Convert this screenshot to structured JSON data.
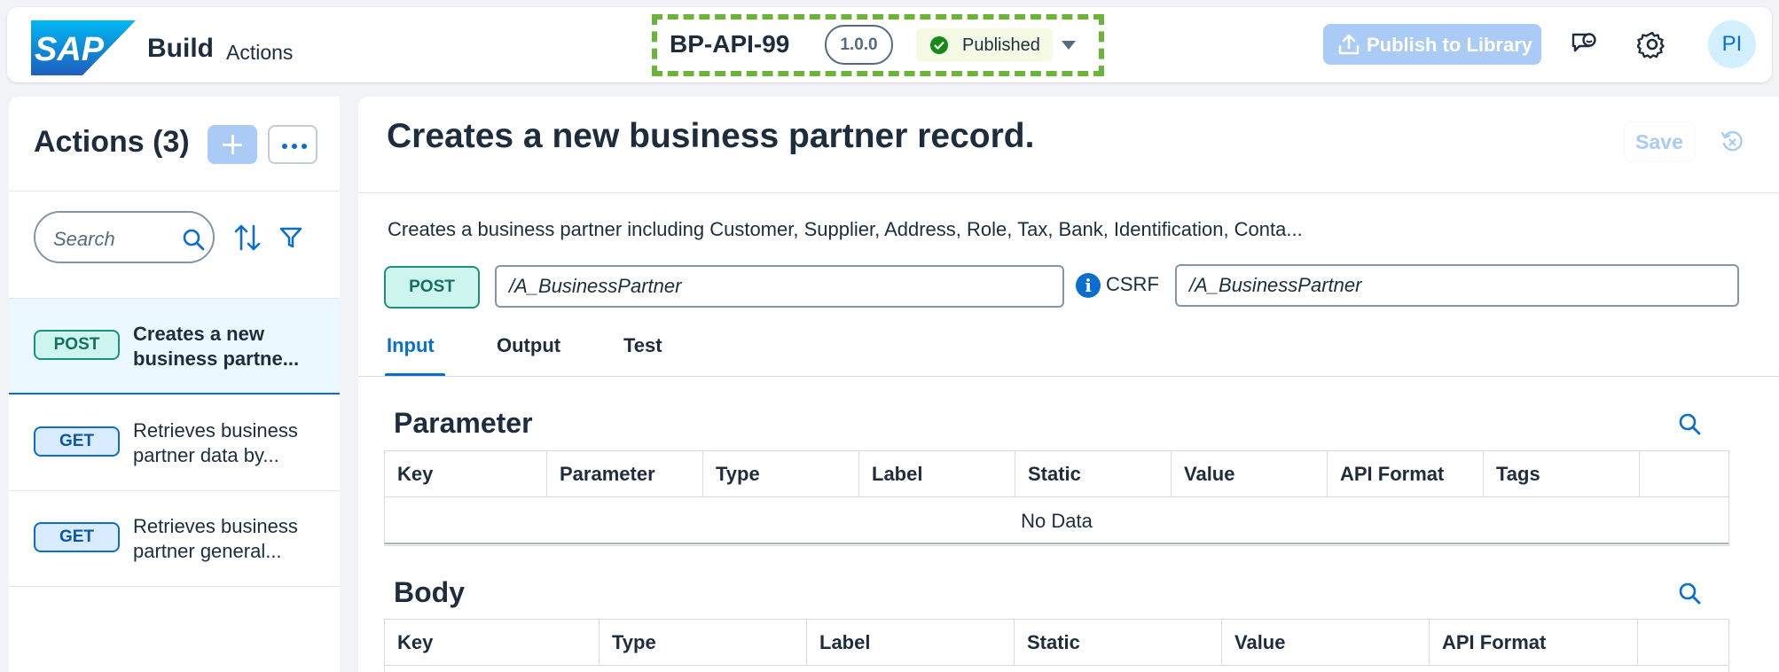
{
  "header": {
    "logo_text": "SAP",
    "app_title": "Build",
    "app_subtitle": "Actions",
    "project_id": "BP-API-99",
    "version": "1.0.0",
    "status": "Published",
    "publish_label": "Publish to Library",
    "avatar_initials": "PI"
  },
  "sidebar": {
    "title": "Actions (3)",
    "search_placeholder": "Search",
    "items": [
      {
        "method": "POST",
        "line1": "Creates a new",
        "line2": "business partne..."
      },
      {
        "method": "GET",
        "line1": "Retrieves business",
        "line2": "partner data by..."
      },
      {
        "method": "GET",
        "line1": "Retrieves business",
        "line2": "partner general..."
      }
    ]
  },
  "main": {
    "title": "Creates a new business partner record.",
    "save_label": "Save",
    "description": "Creates a business partner including Customer, Supplier, Address, Role, Tax, Bank, Identification, Conta...",
    "method": "POST",
    "path": "/A_BusinessPartner",
    "csrf_label": "CSRF",
    "csrf_path": "/A_BusinessPartner",
    "tabs": [
      "Input",
      "Output",
      "Test"
    ],
    "parameter": {
      "title": "Parameter",
      "columns": [
        "Key",
        "Parameter",
        "Type",
        "Label",
        "Static",
        "Value",
        "API Format",
        "Tags",
        ""
      ],
      "empty_text": "No Data"
    },
    "body": {
      "title": "Body",
      "columns": [
        "Key",
        "Type",
        "Label",
        "Static",
        "Value",
        "API Format",
        ""
      ]
    }
  },
  "colors": {
    "accent": "#0a6ed1",
    "post": "#1c8f7e",
    "highlight_dashed": "#6ab43a",
    "published": "#188918"
  }
}
